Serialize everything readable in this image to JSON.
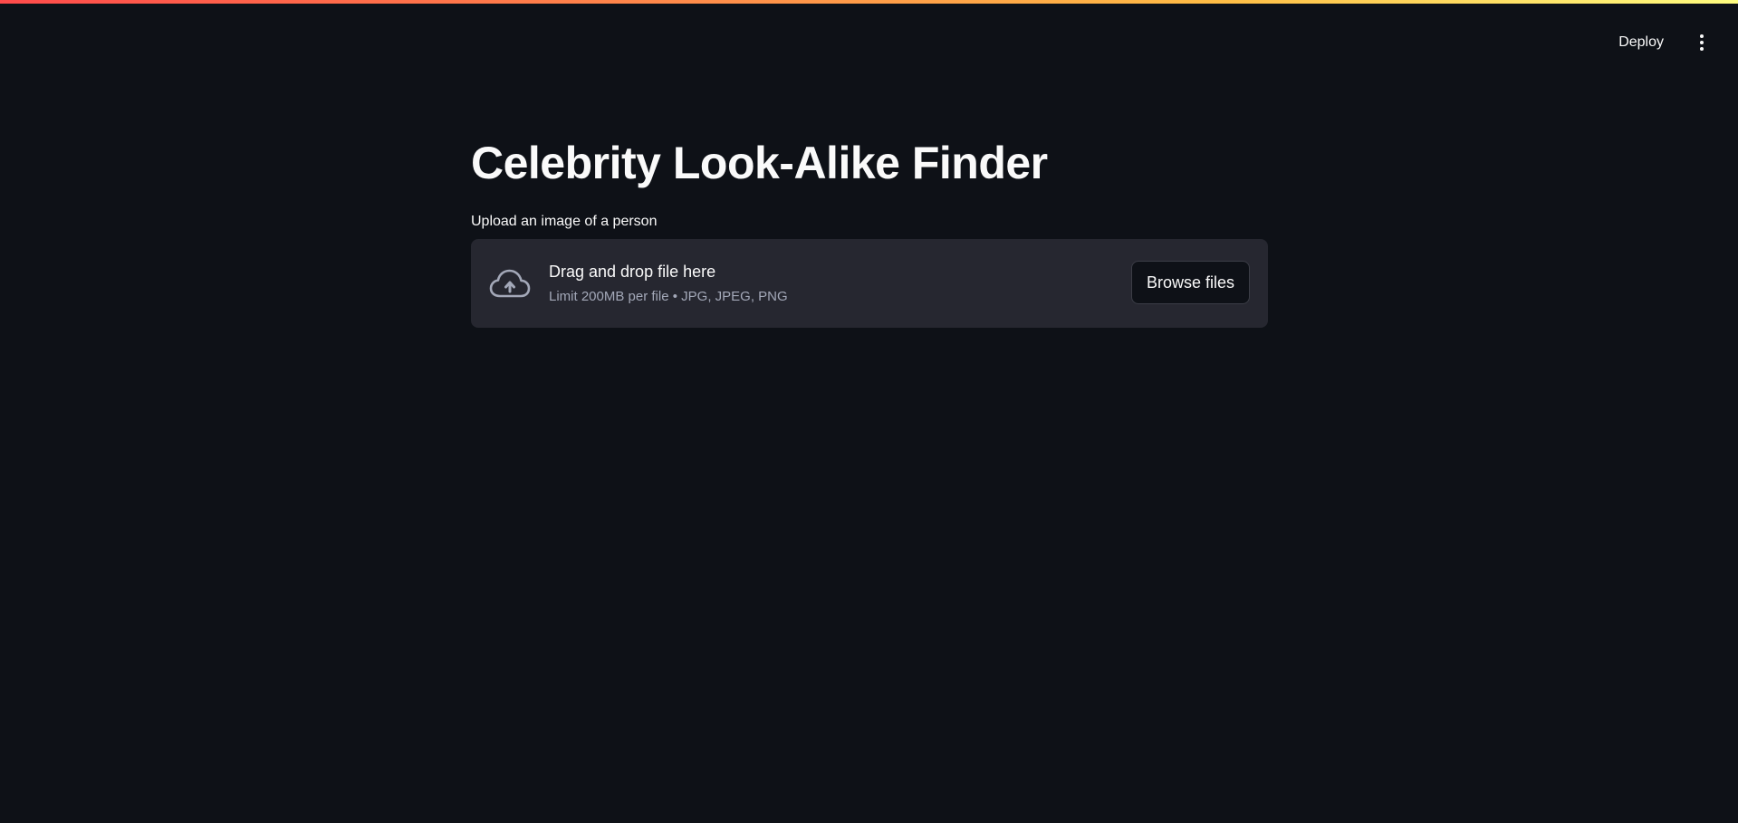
{
  "colors": {
    "background": "#0e1117",
    "dropzone": "#262730",
    "text": "#fafafa",
    "muted_text": "#a3a8b8",
    "accent_gradient": [
      "#ff4b4b",
      "#ffbd45",
      "#fffd80"
    ]
  },
  "header": {
    "deploy_label": "Deploy",
    "menu_icon": "vertical-dots-icon"
  },
  "main": {
    "title": "Celebrity Look-Alike Finder",
    "uploader": {
      "label": "Upload an image of a person",
      "icon": "cloud-upload-icon",
      "drop_title": "Drag and drop file here",
      "drop_subtitle": "Limit 200MB per file • JPG, JPEG, PNG",
      "browse_label": "Browse files"
    }
  }
}
